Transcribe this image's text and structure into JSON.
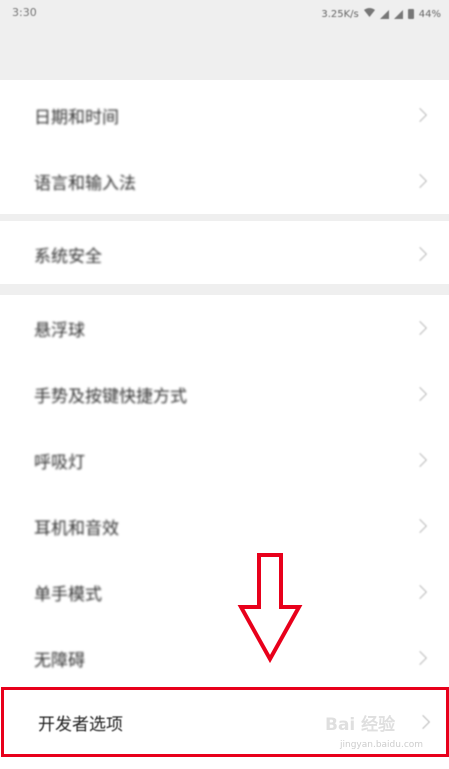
{
  "status_bar": {
    "time": "3:30",
    "speed": "3.25K/s",
    "battery": "44%"
  },
  "groups": [
    {
      "items": [
        {
          "label": "日期和时间",
          "icon": "chevron-right-icon"
        },
        {
          "label": "语言和输入法",
          "icon": "chevron-right-icon"
        }
      ]
    },
    {
      "items": [
        {
          "label": "系统安全",
          "icon": "chevron-right-icon"
        }
      ]
    },
    {
      "items": [
        {
          "label": "悬浮球",
          "icon": "chevron-right-icon"
        },
        {
          "label": "手势及按键快捷方式",
          "icon": "chevron-right-icon"
        },
        {
          "label": "呼吸灯",
          "icon": "chevron-right-icon"
        },
        {
          "label": "耳机和音效",
          "icon": "chevron-right-icon"
        },
        {
          "label": "单手模式",
          "icon": "chevron-right-icon"
        },
        {
          "label": "无障碍",
          "icon": "chevron-right-icon"
        }
      ]
    }
  ],
  "highlighted_item": {
    "label": "开发者选项",
    "icon": "chevron-right-icon"
  },
  "annotation": {
    "arrow": "down-arrow-icon",
    "color": "#e8001b"
  },
  "watermark": {
    "text": "Bai 经验",
    "sub": "jingyan.baidu.com"
  }
}
